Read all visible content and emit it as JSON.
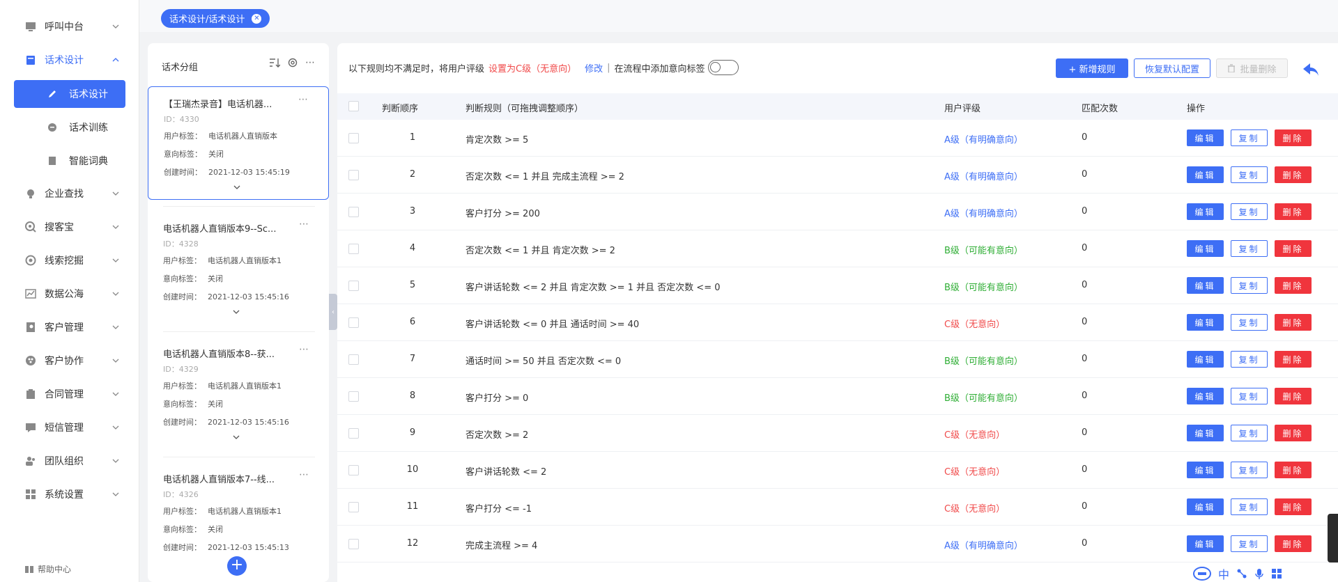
{
  "sidebar": {
    "items": [
      {
        "label": "呼叫中台",
        "icon": "monitor-icon"
      },
      {
        "label": "话术设计",
        "icon": "book-icon"
      },
      {
        "label": "企业查找",
        "icon": "bulb-icon"
      },
      {
        "label": "搜客宝",
        "icon": "search-circle-icon"
      },
      {
        "label": "线索挖掘",
        "icon": "target-icon"
      },
      {
        "label": "数据公海",
        "icon": "chart-icon"
      },
      {
        "label": "客户管理",
        "icon": "contact-icon"
      },
      {
        "label": "客户协作",
        "icon": "team-icon"
      },
      {
        "label": "合同管理",
        "icon": "contract-icon"
      },
      {
        "label": "短信管理",
        "icon": "message-icon"
      },
      {
        "label": "团队组织",
        "icon": "org-icon"
      },
      {
        "label": "系统设置",
        "icon": "grid-icon"
      }
    ],
    "sub_items": [
      {
        "label": "话术设计",
        "icon": "pen-icon"
      },
      {
        "label": "话术训练",
        "icon": "chat-icon"
      },
      {
        "label": "智能词典",
        "icon": "dict-icon"
      }
    ],
    "help": "帮助中心"
  },
  "topbar": {
    "tag": "话术设计/话术设计"
  },
  "group_panel": {
    "title": "话术分组",
    "cards": [
      {
        "title": "【王瑞杰录音】电话机器...",
        "id": "ID：4330",
        "user_tag_label": "用户标签：",
        "user_tag": "电话机器人直销版本",
        "intent_label": "意向标签：",
        "intent": "关闭",
        "created_label": "创建时间：",
        "created": "2021-12-03 15:45:19"
      },
      {
        "title": "电话机器人直销版本9--Sc...",
        "id": "ID：4328",
        "user_tag_label": "用户标签：",
        "user_tag": "电话机器人直销版本1",
        "intent_label": "意向标签：",
        "intent": "关闭",
        "created_label": "创建时间：",
        "created": "2021-12-03 15:45:16"
      },
      {
        "title": "电话机器人直销版本8--获...",
        "id": "ID：4329",
        "user_tag_label": "用户标签：",
        "user_tag": "电话机器人直销版本1",
        "intent_label": "意向标签：",
        "intent": "关闭",
        "created_label": "创建时间：",
        "created": "2021-12-03 15:45:16"
      },
      {
        "title": "电话机器人直销版本7--线...",
        "id": "ID：4326",
        "user_tag_label": "用户标签：",
        "user_tag": "电话机器人直销版本1",
        "intent_label": "意向标签：",
        "intent": "关闭",
        "created_label": "创建时间：",
        "created": "2021-12-03 15:45:13"
      }
    ]
  },
  "rule_bar": {
    "prefix": "以下规则均不满足时，将用户评级",
    "setting": "设置为C级（无意向）",
    "modify": "修改",
    "sep": "|",
    "intent_toggle_label": "在流程中添加意向标签"
  },
  "toolbar": {
    "add_rule": "+ 新增规则",
    "restore": "恢复默认配置",
    "batch_delete": "批量删除"
  },
  "table": {
    "headers": {
      "order": "判断顺序",
      "rule": "判断规则（可拖拽调整顺序）",
      "level": "用户评级",
      "count": "匹配次数",
      "ops": "操作"
    },
    "actions": {
      "edit": "编辑",
      "copy": "复制",
      "delete": "删除"
    },
    "rows": [
      {
        "order": "1",
        "rule": "肯定次数 >= 5",
        "level": "A级（有明确意向）",
        "grade": "A",
        "count": "0"
      },
      {
        "order": "2",
        "rule": "否定次数 <= 1 并且 完成主流程 >= 2",
        "level": "A级（有明确意向）",
        "grade": "A",
        "count": "0"
      },
      {
        "order": "3",
        "rule": "客户打分 >= 200",
        "level": "A级（有明确意向）",
        "grade": "A",
        "count": "0"
      },
      {
        "order": "4",
        "rule": "否定次数 <= 1 并且 肯定次数 >= 2",
        "level": "B级（可能有意向）",
        "grade": "B",
        "count": "0"
      },
      {
        "order": "5",
        "rule": "客户讲话轮数 <= 2 并且 肯定次数 >= 1 并且 否定次数 <= 0",
        "level": "B级（可能有意向）",
        "grade": "B",
        "count": "0"
      },
      {
        "order": "6",
        "rule": "客户讲话轮数 <= 0 并且 通话时间 >= 40",
        "level": "C级（无意向）",
        "grade": "C",
        "count": "0"
      },
      {
        "order": "7",
        "rule": "通话时间 >= 50 并且 否定次数 <= 0",
        "level": "B级（可能有意向）",
        "grade": "B",
        "count": "0"
      },
      {
        "order": "8",
        "rule": "客户打分 >= 0",
        "level": "B级（可能有意向）",
        "grade": "B",
        "count": "0"
      },
      {
        "order": "9",
        "rule": "否定次数 >= 2",
        "level": "C级（无意向）",
        "grade": "C",
        "count": "0"
      },
      {
        "order": "10",
        "rule": "客户讲话轮数 <= 2",
        "level": "C级（无意向）",
        "grade": "C",
        "count": "0"
      },
      {
        "order": "11",
        "rule": "客户打分 <= -1",
        "level": "C级（无意向）",
        "grade": "C",
        "count": "0"
      },
      {
        "order": "12",
        "rule": "完成主流程 >= 4",
        "level": "A级（有明确意向）",
        "grade": "A",
        "count": "0"
      }
    ]
  },
  "footer_tools": {
    "ime": "中"
  },
  "colors": {
    "accent": "#3d6ef5",
    "grade_a": "#3d6ef5",
    "grade_b": "#2fae35",
    "grade_c": "#f04a4a",
    "danger": "#f0353d"
  }
}
